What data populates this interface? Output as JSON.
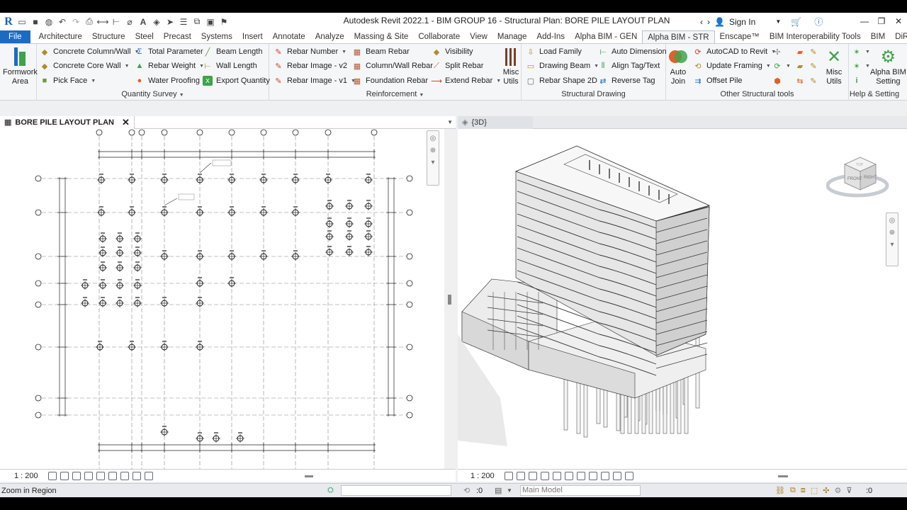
{
  "app": {
    "title": "Autodesk Revit 2022.1 - BIM GROUP 16 - Structural Plan: BORE PILE LAYOUT PLAN",
    "sign_in": "Sign In"
  },
  "tabs": [
    "File",
    "Architecture",
    "Structure",
    "Steel",
    "Precast",
    "Systems",
    "Insert",
    "Annotate",
    "Analyze",
    "Massing & Site",
    "Collaborate",
    "View",
    "Manage",
    "Add-Ins",
    "Alpha BIM - GEN",
    "Alpha BIM - STR",
    "Enscape™",
    "BIM Interoperability Tools",
    "BIM",
    "DiRoots"
  ],
  "active_tab": "Alpha BIM - STR",
  "ribbon": {
    "formwork": {
      "label1": "Formwork",
      "label2": "Area"
    },
    "quantity_survey": {
      "title": "Quantity Survey",
      "items": [
        "Concrete Column/Wall",
        "Concrete Core Wall",
        "Pick Face",
        "Total Parameter",
        "Rebar Weight",
        "Water Proofing",
        "Beam Length",
        "Wall Length",
        "Export Quantity"
      ]
    },
    "reinforcement": {
      "title": "Reinforcement",
      "items": [
        "Rebar Number",
        "Rebar Image - v2",
        "Rebar Image - v1",
        "Beam Rebar",
        "Column/Wall Rebar",
        "Foundation Rebar",
        "Visibility",
        "Split Rebar",
        "Extend Rebar"
      ]
    },
    "misc_utils": {
      "label1": "Misc",
      "label2": "Utils"
    },
    "structural_drawing": {
      "title": "Structural Drawing",
      "items": [
        "Load Family",
        "Drawing Beam",
        "Rebar Shape 2D",
        "Auto Dimension",
        "Align Tag/Text",
        "Reverse Tag"
      ]
    },
    "other_tools": {
      "title": "Other Structural tools",
      "auto_join1": "Auto",
      "auto_join2": "Join",
      "items": [
        "AutoCAD to Revit",
        "Update Framing",
        "Offset Pile"
      ]
    },
    "help": {
      "title": "Help & Setting",
      "label1": "Alpha BIM",
      "label2": "Setting",
      "misc1": "Misc",
      "misc2": "Utils"
    }
  },
  "views": {
    "left": {
      "title": "BORE PILE LAYOUT PLAN",
      "scale": "1 : 200"
    },
    "right": {
      "title": "{3D}",
      "scale": "1 : 200"
    }
  },
  "viewcube": {
    "front": "FRONT",
    "right": "RIGHT",
    "top": "TOP"
  },
  "status": {
    "message": "Zoom in Region",
    "coord": ":0",
    "model": "Main Model",
    "filter": ":0"
  }
}
